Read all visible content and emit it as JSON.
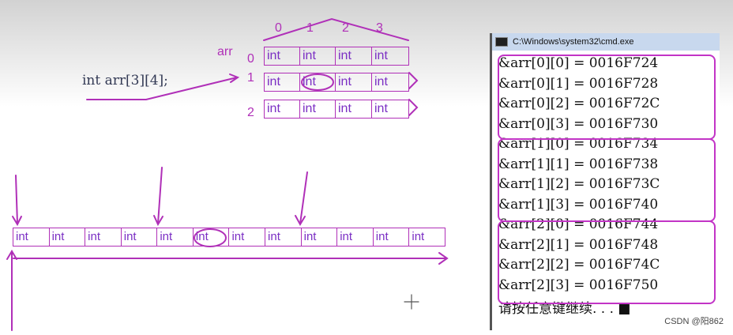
{
  "declaration": "int arr[3][4];",
  "array_name": "arr",
  "col_indices": [
    "0",
    "1",
    "2",
    "3"
  ],
  "row_indices": [
    "0",
    "1",
    "2"
  ],
  "cell_label": "int",
  "console": {
    "title": "C:\\Windows\\system32\\cmd.exe",
    "lines": [
      "&arr[0][0] = 0016F724",
      "&arr[0][1] = 0016F728",
      "&arr[0][2] = 0016F72C",
      "&arr[0][3] = 0016F730",
      "&arr[1][0] = 0016F734",
      "&arr[1][1] = 0016F738",
      "&arr[1][2] = 0016F73C",
      "&arr[1][3] = 0016F740",
      "&arr[2][0] = 0016F744",
      "&arr[2][1] = 0016F748",
      "&arr[2][2] = 0016F74C",
      "&arr[2][3] = 0016F750"
    ],
    "prompt": "请按任意键继续. . . ■"
  },
  "watermark": "CSDN @阳862",
  "colors": {
    "annotation": "#b030b8",
    "cell_text": "#7b2fc4"
  }
}
